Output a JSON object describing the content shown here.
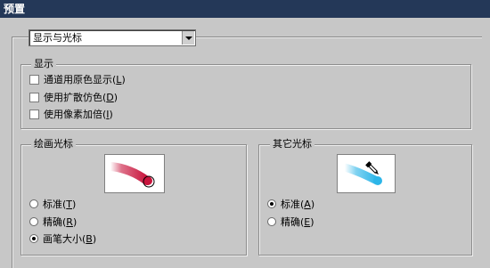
{
  "window": {
    "title": "预置"
  },
  "category_select": {
    "value": "显示与光标"
  },
  "display_group": {
    "label": "显示",
    "options": [
      {
        "text": "通道用原色显示(",
        "key": "L",
        "suffix": ")",
        "checked": false
      },
      {
        "text": "使用扩散仿色(",
        "key": "D",
        "suffix": ")",
        "checked": false
      },
      {
        "text": "使用像素加倍(",
        "key": "I",
        "suffix": ")",
        "checked": false
      }
    ]
  },
  "painting_cursors": {
    "label": "绘画光标",
    "options": [
      {
        "text": "标准(",
        "key": "T",
        "suffix": ")",
        "selected": false
      },
      {
        "text": "精确(",
        "key": "R",
        "suffix": ")",
        "selected": false
      },
      {
        "text": "画笔大小(",
        "key": "B",
        "suffix": ")",
        "selected": true
      }
    ],
    "preview_color": "#c8143c"
  },
  "other_cursors": {
    "label": "其它光标",
    "options": [
      {
        "text": "标准(",
        "key": "A",
        "suffix": ")",
        "selected": true
      },
      {
        "text": "精确(",
        "key": "E",
        "suffix": ")",
        "selected": false
      }
    ],
    "preview_color": "#2cb5e8"
  },
  "colors": {
    "title_bar": "#243858",
    "dialog_bg": "#c7c7c7"
  }
}
